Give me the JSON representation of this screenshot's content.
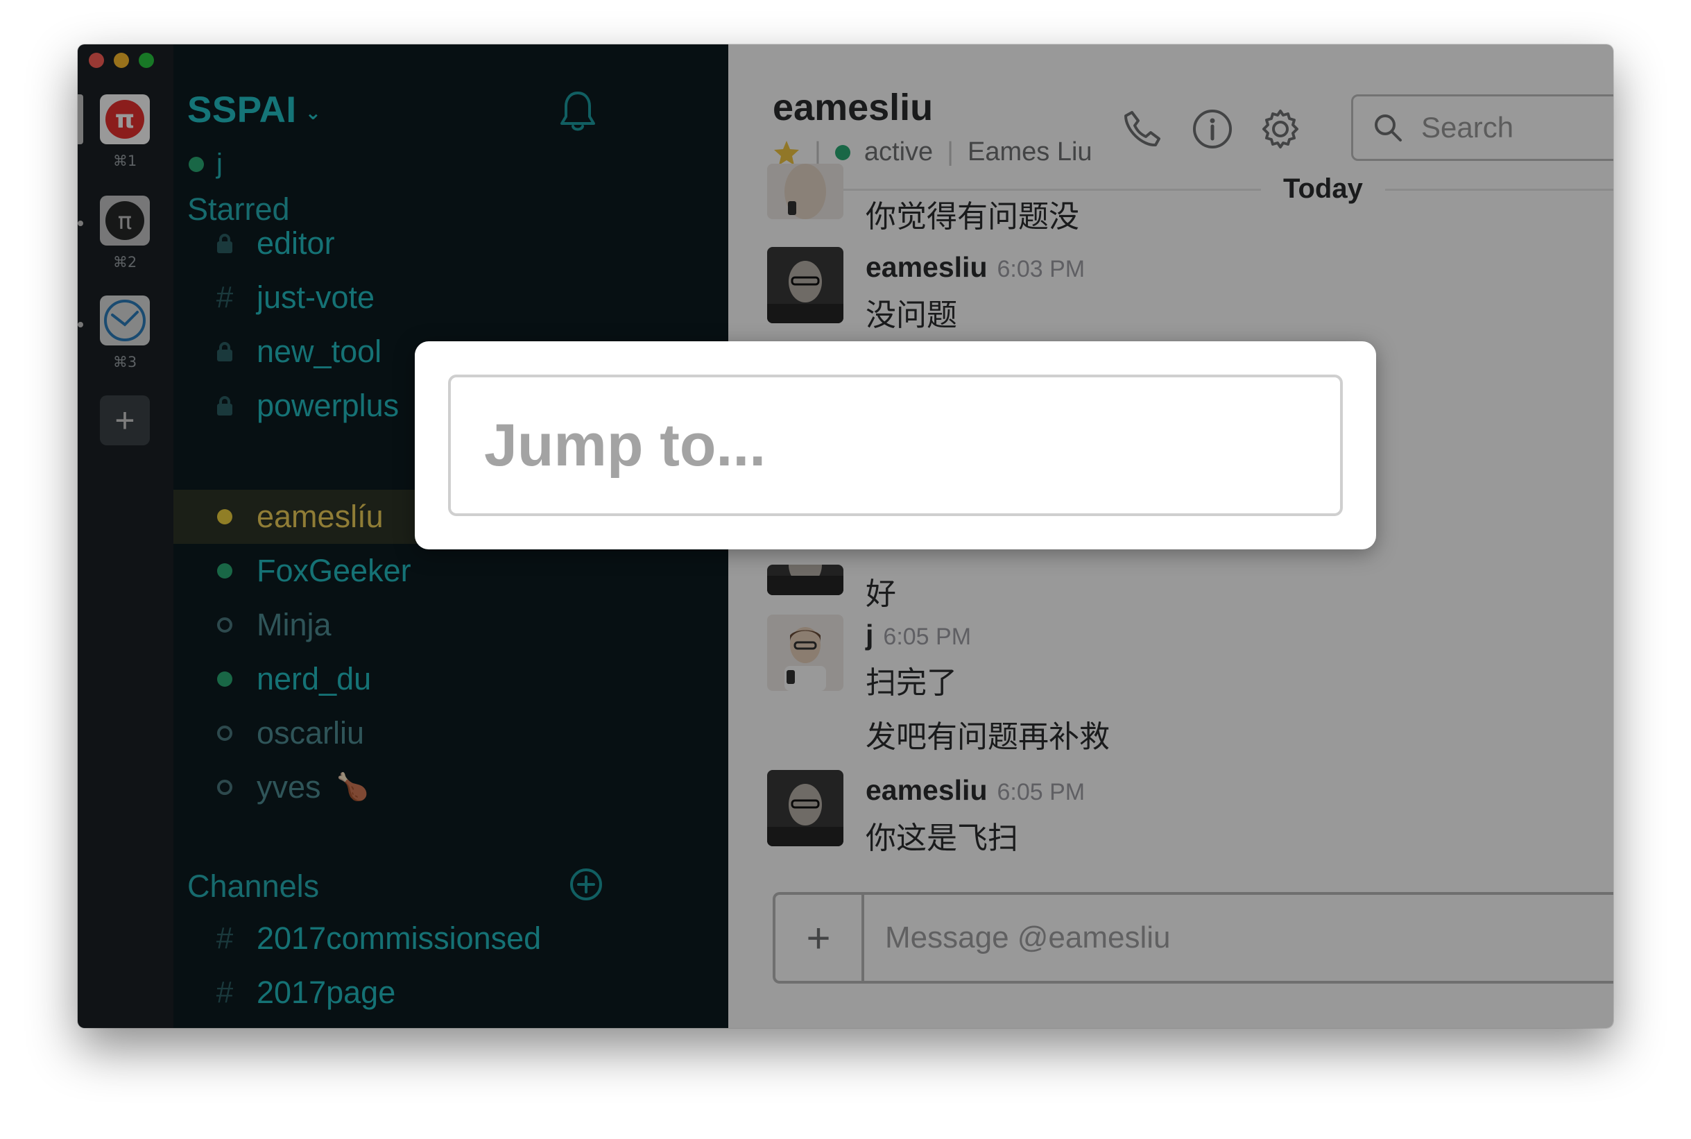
{
  "teams": [
    {
      "shortcut": "⌘1"
    },
    {
      "shortcut": "⌘2"
    },
    {
      "shortcut": "⌘3"
    }
  ],
  "sidebar": {
    "team_name": "SSPAI",
    "user": "j",
    "starred_title": "Starred",
    "starred": [
      {
        "lead": "lock",
        "label": "editor"
      },
      {
        "lead": "#",
        "label": "just-vote"
      },
      {
        "lead": "lock",
        "label": "new_tool"
      },
      {
        "lead": "lock",
        "label": "powerplus"
      },
      {
        "lead": "presence-away-active",
        "label": "eameslíu"
      },
      {
        "lead": "presence-active",
        "label": "FoxGeeker"
      },
      {
        "lead": "presence-away",
        "label": "Minja"
      },
      {
        "lead": "presence-active",
        "label": "nerd_du"
      },
      {
        "lead": "presence-away",
        "label": "oscarliu"
      },
      {
        "lead": "presence-away",
        "label": "yves",
        "extra": "🍗"
      }
    ],
    "channels_title": "Channels",
    "channels": [
      {
        "lead": "#",
        "label": "2017commissionsed"
      },
      {
        "lead": "#",
        "label": "2017page"
      }
    ]
  },
  "header": {
    "title": "eamesliu",
    "status": "active",
    "full_name": "Eames Liu",
    "search_placeholder": "Search"
  },
  "messages": {
    "day": "Today",
    "items": [
      {
        "text": "你觉得有问题没"
      },
      {
        "name": "eamesliu",
        "time": "6:03 PM",
        "text": "没问题"
      },
      {
        "text": "好"
      },
      {
        "name": "j",
        "time": "6:05 PM",
        "text": "扫完了"
      },
      {
        "text": "发吧有问题再补救"
      },
      {
        "name": "eamesliu",
        "time": "6:05 PM",
        "text": "你这是飞扫"
      }
    ]
  },
  "composer": {
    "placeholder": "Message @eamesliu"
  },
  "jump": {
    "placeholder": "Jump to..."
  },
  "colors": {
    "sidebar_bg": "#0d1b20",
    "team_bg": "#1b2126",
    "accent_teal": "#23c4c8",
    "presence_green": "#2bac76",
    "active_yellow": "#f0d15a",
    "brand_red": "#e8312f"
  }
}
